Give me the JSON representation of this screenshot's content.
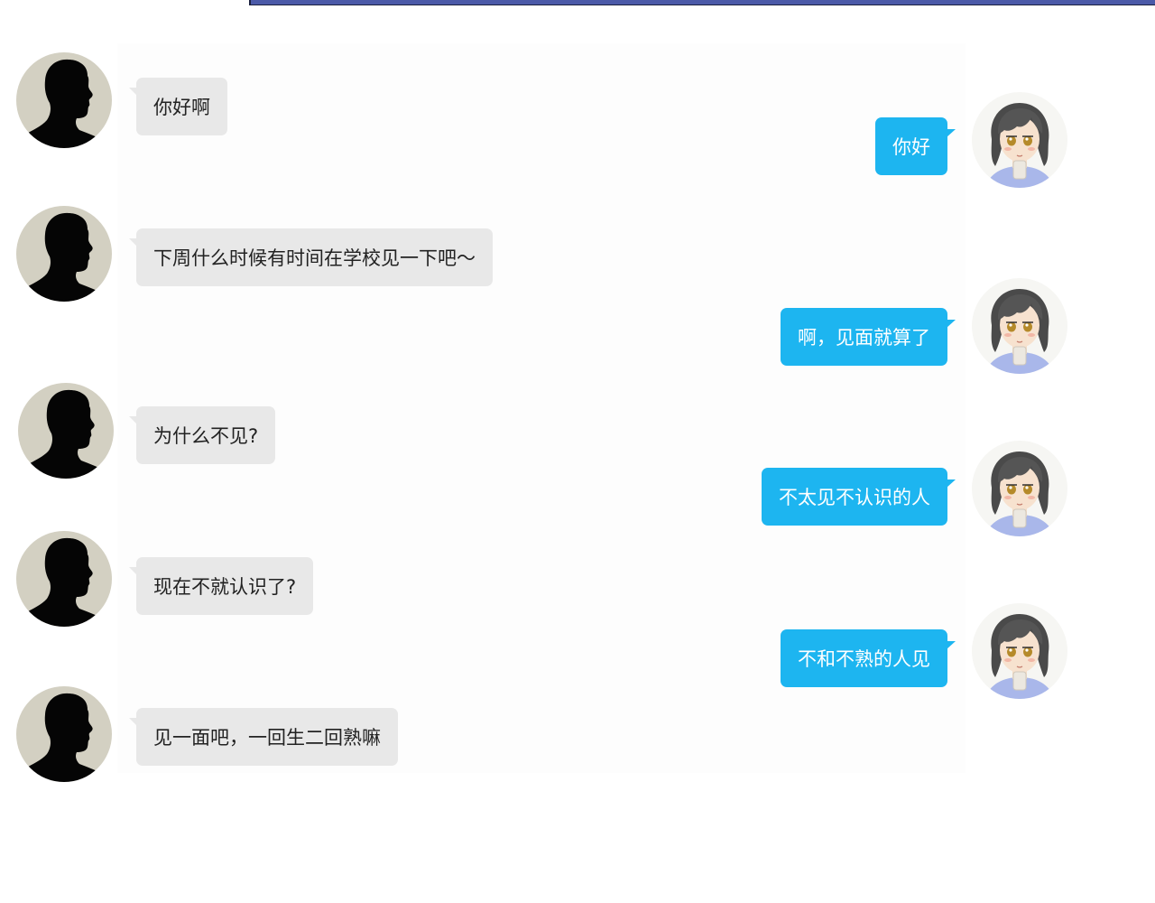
{
  "chat": {
    "messages": [
      {
        "side": "left",
        "sender_icon": "male-silhouette-icon",
        "text": "你好啊"
      },
      {
        "side": "right",
        "sender_icon": "anime-girl-avatar-icon",
        "text": "你好"
      },
      {
        "side": "left",
        "sender_icon": "male-silhouette-icon",
        "text": "下周什么时候有时间在学校见一下吧～"
      },
      {
        "side": "right",
        "sender_icon": "anime-girl-avatar-icon",
        "text": "啊，见面就算了"
      },
      {
        "side": "left",
        "sender_icon": "male-silhouette-icon",
        "text": "为什么不见?"
      },
      {
        "side": "right",
        "sender_icon": "anime-girl-avatar-icon",
        "text": "不太见不认识的人"
      },
      {
        "side": "left",
        "sender_icon": "male-silhouette-icon",
        "text": "现在不就认识了?"
      },
      {
        "side": "right",
        "sender_icon": "anime-girl-avatar-icon",
        "text": "不和不熟的人见"
      },
      {
        "side": "left",
        "sender_icon": "male-silhouette-icon",
        "text": "见一面吧，一回生二回熟嘛"
      }
    ]
  },
  "colors": {
    "incoming_bubble": "#e8e8e8",
    "outgoing_bubble": "#1db5f0",
    "incoming_text": "#222222",
    "outgoing_text": "#ffffff",
    "male_avatar_bg": "#d3d0c2",
    "top_strip": "#4b5aa8"
  }
}
